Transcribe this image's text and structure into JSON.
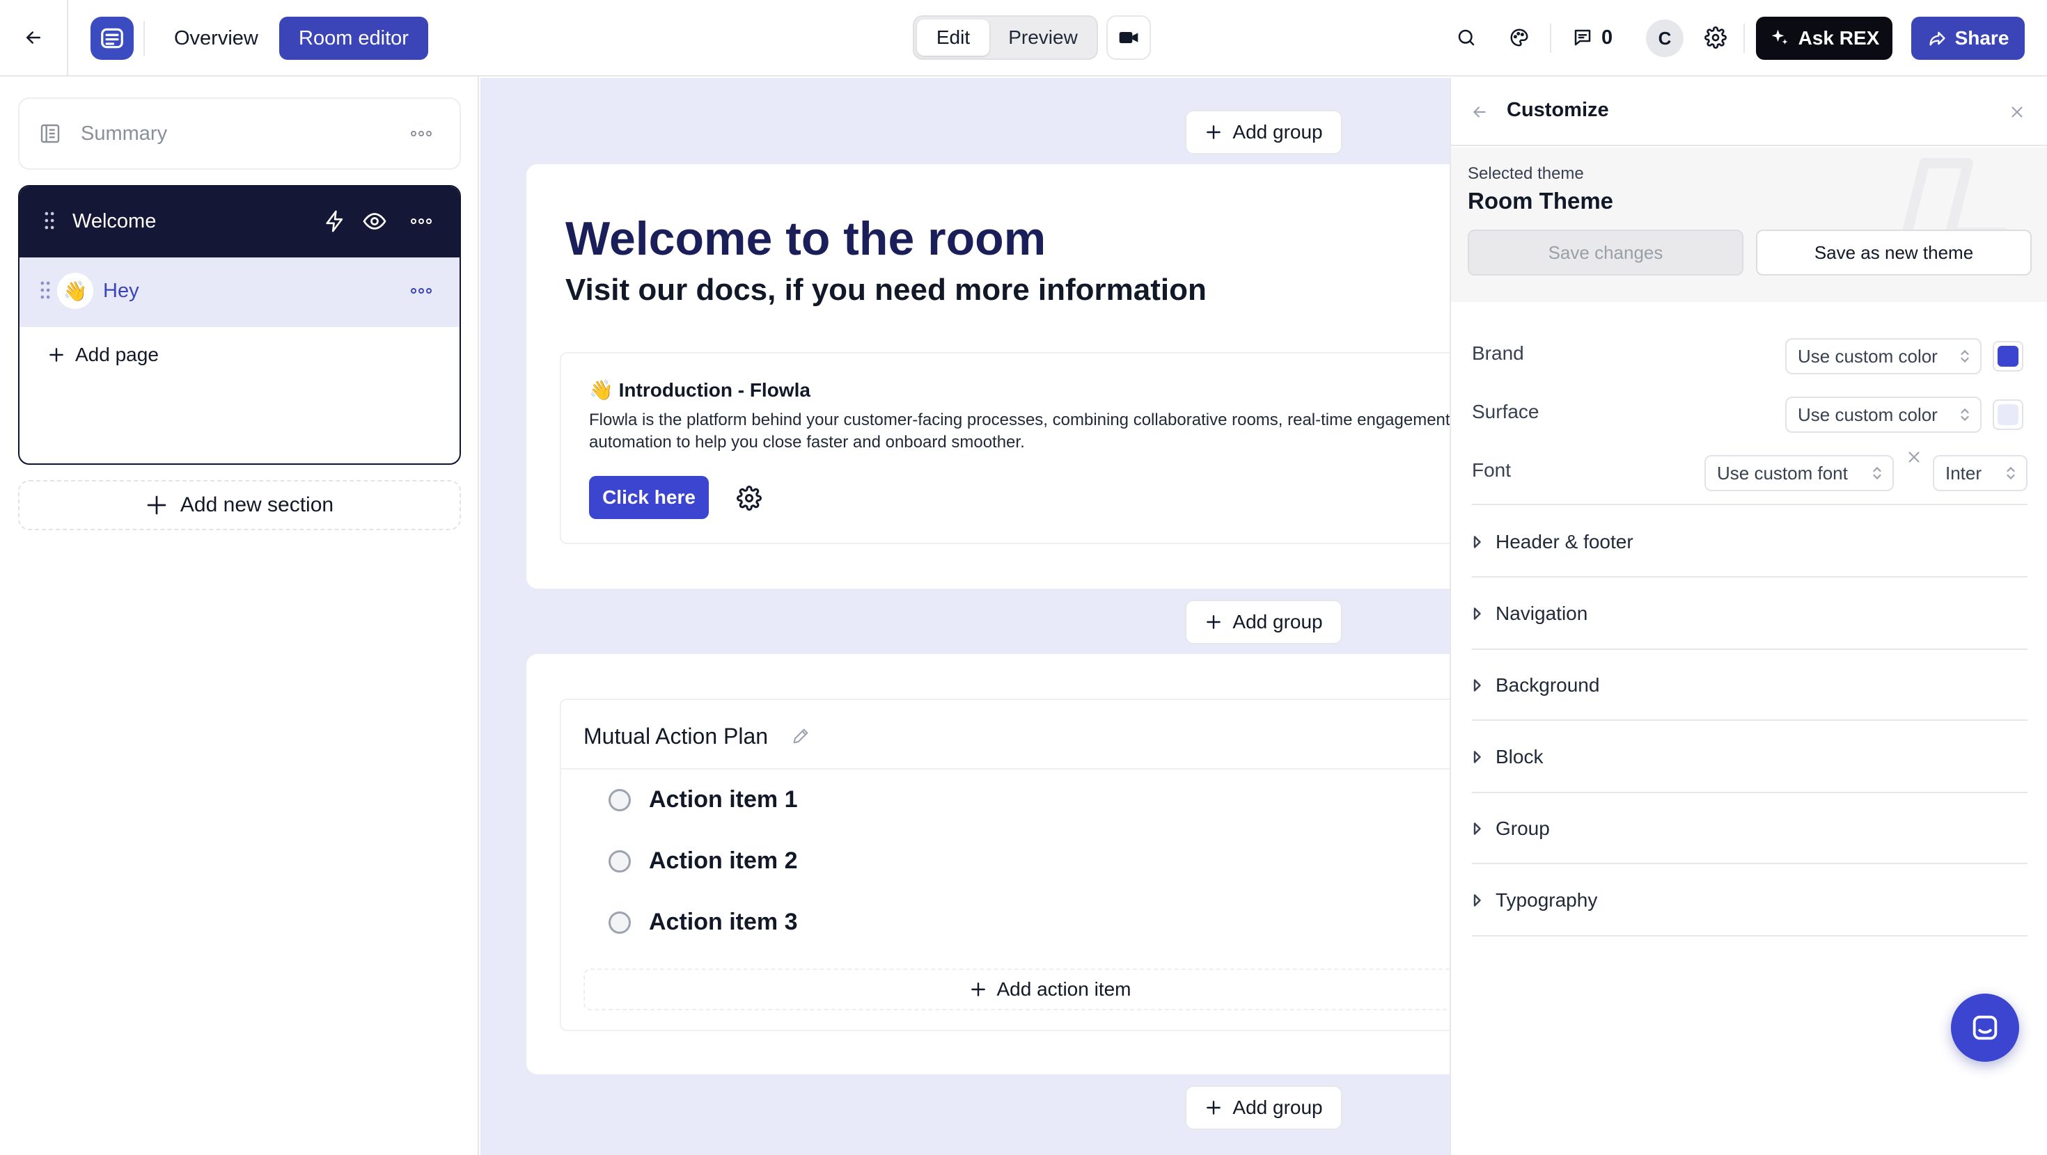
{
  "topbar": {
    "tabs": {
      "overview": "Overview",
      "room_editor": "Room editor"
    },
    "mode": {
      "edit": "Edit",
      "preview": "Preview",
      "active": "Edit"
    },
    "comments_count": "0",
    "avatar_initial": "C",
    "ask_label": "Ask REX",
    "share_label": "Share"
  },
  "sidebar": {
    "summary_label": "Summary",
    "section": {
      "title": "Welcome",
      "pages": [
        {
          "emoji": "👋",
          "title": "Hey"
        }
      ],
      "add_page_label": "Add page"
    },
    "add_section_label": "Add new section"
  },
  "canvas": {
    "add_group_label": "Add group",
    "welcome": {
      "title": "Welcome to the room",
      "subtitle": "Visit our docs, if you need more information"
    },
    "intro": {
      "title": "👋 Introduction - Flowla",
      "text": "Flowla is the platform behind your customer-facing processes, combining collaborative rooms, real-time engagement\nautomation to help you close faster and onboard smoother.",
      "button_label": "Click here"
    },
    "action_plan": {
      "title": "Mutual Action Plan",
      "items": [
        "Action item 1",
        "Action item 2",
        "Action item 3"
      ],
      "add_label": "Add action item"
    }
  },
  "panel": {
    "title": "Customize",
    "selected_theme_label": "Selected theme",
    "theme_name": "Room Theme",
    "save_changes_label": "Save changes",
    "save_new_label": "Save as new theme",
    "brand": {
      "label": "Brand",
      "mode": "Use custom color",
      "color": "#3b45d0"
    },
    "surface": {
      "label": "Surface",
      "mode": "Use custom color",
      "color": "#e9eaf9"
    },
    "font": {
      "label": "Font",
      "mode": "Use custom font",
      "value": "Inter"
    },
    "sections": [
      "Header & footer",
      "Navigation",
      "Background",
      "Block",
      "Group",
      "Typography"
    ]
  },
  "colors": {
    "brand": "#3b45b8",
    "dark": "#141836",
    "canvas_bg": "#e9eaf9",
    "accent_button": "#3b45d0"
  }
}
